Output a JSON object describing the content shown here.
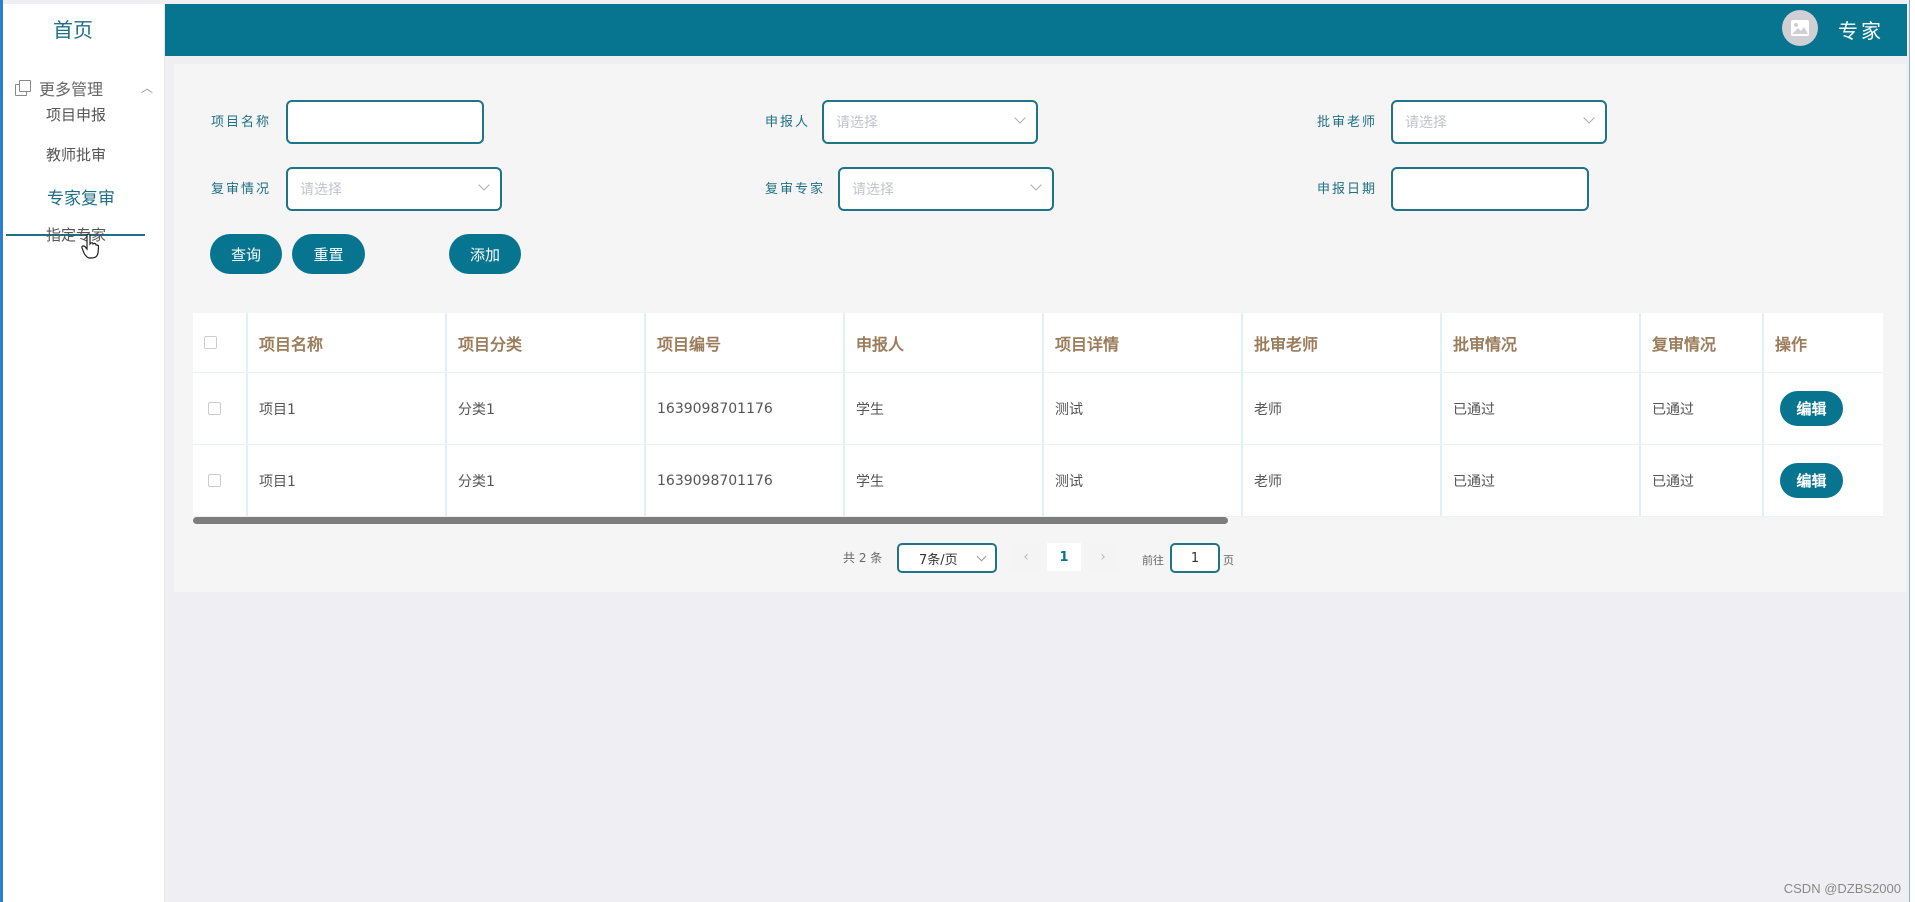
{
  "sidebar": {
    "home": "首页",
    "group_label": "更多管理",
    "items": [
      {
        "label": "项目申报"
      },
      {
        "label": "教师批审"
      },
      {
        "label": "专家复审"
      },
      {
        "label": "指定专家"
      }
    ]
  },
  "header": {
    "user_name": "专家"
  },
  "filters": {
    "project_name_label": "项目名称",
    "applicant_label": "申报人",
    "applicant_placeholder": "请选择",
    "approver_label": "批审老师",
    "approver_placeholder": "请选择",
    "review_status_label": "复审情况",
    "review_status_placeholder": "请选择",
    "review_expert_label": "复审专家",
    "review_expert_placeholder": "请选择",
    "date_label": "申报日期"
  },
  "buttons": {
    "query": "查询",
    "reset": "重置",
    "add": "添加"
  },
  "table": {
    "headers": [
      "项目名称",
      "项目分类",
      "项目编号",
      "申报人",
      "项目详情",
      "批审老师",
      "批审情况",
      "复审情况",
      "操作"
    ],
    "rows": [
      {
        "name": "项目1",
        "category": "分类1",
        "number": "1639098701176",
        "applicant": "学生",
        "detail": "测试",
        "teacher": "老师",
        "approval": "已通过",
        "review": "已通过",
        "action": "编辑"
      },
      {
        "name": "项目1",
        "category": "分类1",
        "number": "1639098701176",
        "applicant": "学生",
        "detail": "测试",
        "teacher": "老师",
        "approval": "已通过",
        "review": "已通过",
        "action": "编辑"
      }
    ]
  },
  "pagination": {
    "total": "共 2 条",
    "page_size": "7条/页",
    "prev": "‹",
    "current": "1",
    "next": "›",
    "goto_label": "前往",
    "goto_value": "1",
    "page_suffix": "页"
  },
  "watermark": "CSDN @DZBS2000",
  "colors": {
    "primary": "#087590",
    "header_text": "#9b7d5c",
    "label": "#1f6f84"
  }
}
